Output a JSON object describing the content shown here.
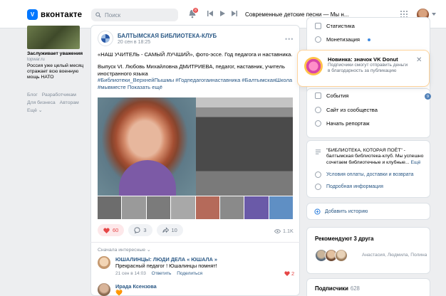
{
  "header": {
    "logo_text": "вконтакте",
    "search_placeholder": "Поиск",
    "notifications_count": "8",
    "now_playing": "Современные детские песни — Мы н..."
  },
  "left_ad": {
    "title": "Заслуживает уважения",
    "domain": "topwar.ru",
    "text": "Россия уже целый месяц отражает всю военную мощь НАТО"
  },
  "footer_links": {
    "blog": "Блог",
    "developers": "Разработчикам",
    "business": "Для бизнеса",
    "authors": "Авторам",
    "more": "Ещё ⌄"
  },
  "post": {
    "author": "БАЛТЫМСКАЯ БИБЛИОТЕКА-КЛУБ",
    "date": "20 сен в 18:25",
    "more": "•••",
    "line1": "«НАШ УЧИТЕЛЬ - САМЫЙ ЛУЧШИЙ», фото-эссе. Год педагога и наставника.",
    "line2": "Выпуск VI. Любовь Михайловна ДМИТРИЕВА, педагог, наставник, учитель иностранного языка",
    "hashtags1": "#Библиотеки_ВерхнейПышмы #Годпедагогаинаставника #БалтымскаяШкола",
    "hashtags2": "#мывместе",
    "show_more": "Показать ещё",
    "likes": "60",
    "comments": "3",
    "shares": "10",
    "views": "1.1K"
  },
  "comments": {
    "sort_label": "Сначала интересные ⌄",
    "c1_name": "ЮШАЛИНЦЫ: ЛЮДИ ДЕЛА « ЮШАЛА »",
    "c1_text": "Прекрасный педагог ! Юшалинцы помнят!",
    "c1_date": "21 сен в 14:03",
    "c1_reply": "Ответить",
    "c1_share": "Поделиться",
    "c1_likes": "2",
    "c2_name": "Ирада Ксензова",
    "c2_text": "🧡"
  },
  "right_menu": {
    "stats": "Статистика",
    "monetization": "Монетизация",
    "events": "События",
    "events_badge": "9",
    "site": "Сайт из сообщества",
    "live": "Начать репортаж"
  },
  "donut_popup": {
    "title": "Новинка: значок VK Donut",
    "text": "Подписчики смогут отправить деньги в благодарность за публикацию",
    "close": "✕"
  },
  "group_info": {
    "desc": "\"БИБЛИОТЕКА, КОТОРАЯ ПОЁТ\" - балтымская библиотека-клуб. Мы успешно сочетаем библиотечные и клубные...",
    "more": "Ещё",
    "payment": "Условия оплаты, доставки и возврата",
    "details": "Подробная информация"
  },
  "stories": {
    "add": "Добавить историю"
  },
  "friends": {
    "title": "Рекомендуют 3 друга",
    "names": "Анастасия, Людмила, Полина"
  },
  "subscribers": {
    "title": "Подписчики",
    "count": "628"
  }
}
